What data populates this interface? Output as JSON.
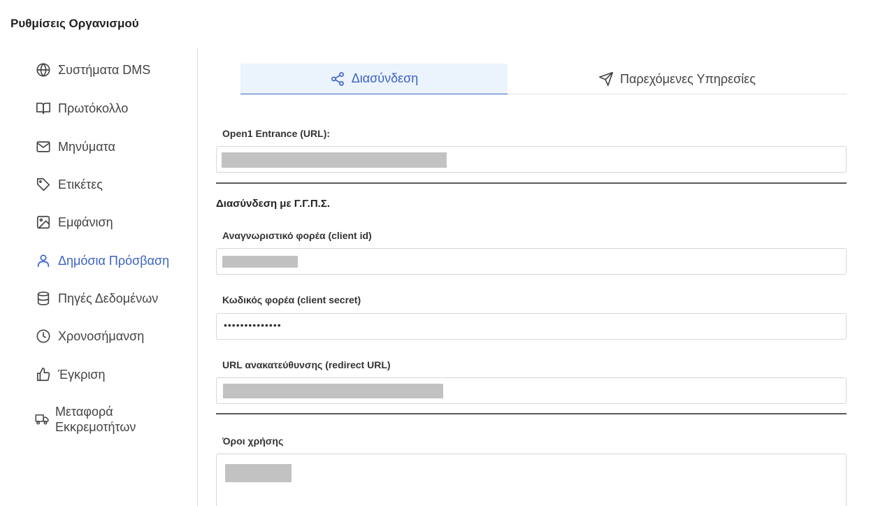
{
  "page": {
    "title": "Ρυθμίσεις Οργανισμού"
  },
  "sidebar": {
    "items": [
      {
        "label": "Συστήματα DMS",
        "icon": "globe-icon"
      },
      {
        "label": "Πρωτόκολλο",
        "icon": "book-open-icon"
      },
      {
        "label": "Μηνύματα",
        "icon": "mail-icon"
      },
      {
        "label": "Ετικέτες",
        "icon": "tag-icon"
      },
      {
        "label": "Εμφάνιση",
        "icon": "image-icon"
      },
      {
        "label": "Δημόσια Πρόσβαση",
        "icon": "user-icon",
        "active": true
      },
      {
        "label": "Πηγές Δεδομένων",
        "icon": "database-icon"
      },
      {
        "label": "Χρονοσήμανση",
        "icon": "clock-icon"
      },
      {
        "label": "Έγκριση",
        "icon": "thumbs-up-icon"
      },
      {
        "label": "Μεταφορά Εκκρεμοτήτων",
        "icon": "truck-icon"
      }
    ]
  },
  "tabs": [
    {
      "label": "Διασύνδεση",
      "icon": "share-icon",
      "active": true
    },
    {
      "label": "Παρεχόμενες Υπηρεσίες",
      "icon": "send-icon",
      "active": false
    }
  ],
  "form": {
    "entrance_url_label": "Open1 Entrance (URL):",
    "ggps_heading": "Διασύνδεση με Γ.Γ.Π.Σ.",
    "client_id_label": "Αναγνωριστικό φορέα (client id)",
    "client_secret_label": "Κωδικός φορέα (client secret)",
    "client_secret_value": "••••••••••••••",
    "redirect_url_label": "URL ανακατεύθυνσης (redirect URL)",
    "terms_label": "Όροι χρήσης"
  },
  "colors": {
    "accent": "#3b62c4",
    "active_tab_bg": "#ebf3fd",
    "redaction": "#c2c2c2"
  }
}
